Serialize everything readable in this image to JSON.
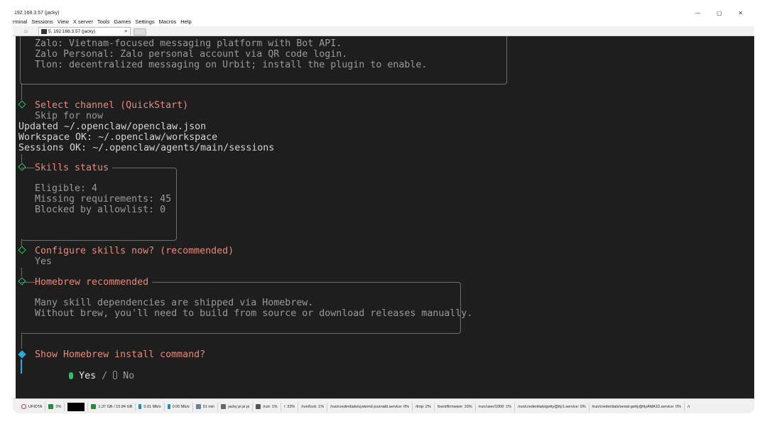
{
  "window": {
    "title": "192.168.3.57 (jacky)",
    "controls": "— ▢ ✕"
  },
  "menu": [
    "Terminal",
    "Sessions",
    "View",
    "X server",
    "Tools",
    "Games",
    "Settings",
    "Macros",
    "Help"
  ],
  "tabs": [
    {
      "label": "5. 192.168.3.57 (jacky)",
      "close": "✕"
    }
  ],
  "tab_edge_text": "t",
  "terminal": {
    "lines_top": [
      "Zalo: Vietnam-focused messaging platform with Bot API.",
      "Zalo Personal: Zalo personal account via QR code login.",
      "Tlon: decentralized messaging on Urbit; install the plugin to enable."
    ],
    "select_channel_title": "Select channel (QuickStart)",
    "select_channel_value": "Skip for now",
    "updated_line": "Updated ~/.openclaw/openclaw.json",
    "workspace_line": "Workspace OK: ~/.openclaw/workspace",
    "sessions_line": "Sessions OK: ~/.openclaw/agents/main/sessions",
    "skills_status_title": "Skills status",
    "skills_eligible": "Eligible: 4",
    "skills_missing": "Missing requirements: 45",
    "skills_blocked": "Blocked by allowlist: 0",
    "configure_title": "Configure skills now? (recommended)",
    "configure_value": "Yes",
    "homebrew_title": "Homebrew recommended",
    "homebrew_line1": "Many skill dependencies are shipped via Homebrew.",
    "homebrew_line2": "Without brew, you'll need to build from source or download releases manually.",
    "show_cmd_title": "Show Homebrew install command?",
    "option_yes": "Yes",
    "separator": "/",
    "option_no": "No",
    "colors": {
      "background": "#1e1e1e",
      "prompt": "#e8897d",
      "check": "#25c46b",
      "active": "#2aa9e0"
    }
  },
  "statusbar": [
    {
      "icon": "power-icon",
      "text": "UFIDTA"
    },
    {
      "icon": "cpu-icon",
      "text": "0%"
    },
    {
      "icon": "graph-icon",
      "text": ""
    },
    {
      "icon": "memory-icon",
      "text": "1.37 GB / 15.84 GB"
    },
    {
      "icon": "upload-icon",
      "text": "0.01 Mb/s"
    },
    {
      "icon": "download-icon",
      "text": "0.00 Mb/s"
    },
    {
      "icon": "uptime-icon",
      "text": "51 min"
    },
    {
      "icon": "user-icon",
      "text": "jacky  pi  pi  pi"
    },
    {
      "icon": "disk-icon",
      "text": "/run: 1%"
    },
    {
      "icon": "",
      "text": "/: 33%"
    },
    {
      "icon": "",
      "text": "/run/lock: 1%"
    },
    {
      "icon": "",
      "text": "/run/credentials/systemd-journald.service: 0%"
    },
    {
      "icon": "",
      "text": "/tmp: 2%"
    },
    {
      "icon": "",
      "text": "/boot/firmware: 16%"
    },
    {
      "icon": "",
      "text": "/run/user/1000: 1%"
    },
    {
      "icon": "",
      "text": "/run/credentials/getty@tty1.service: 0%"
    },
    {
      "icon": "",
      "text": "/run/credentials/serial-getty@ttyAMA10.service: 0%"
    },
    {
      "icon": "",
      "text": "/r"
    }
  ]
}
